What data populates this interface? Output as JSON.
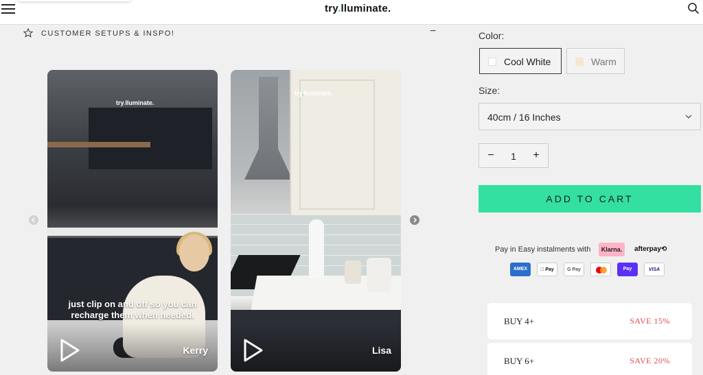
{
  "header": {
    "brand_prefix": "try",
    "brand_dot": ".",
    "brand_suffix": "lluminate."
  },
  "section": {
    "title": "CUSTOMER SETUPS & INSPO!",
    "collapse_symbol": "−"
  },
  "videos": [
    {
      "logo_prefix": "try",
      "logo_dot": ".",
      "logo_suffix": "lluminate.",
      "caption": "just clip on and off so you can recharge them when needed.",
      "name": "Kerry"
    },
    {
      "logo_prefix": "try",
      "logo_dot": ".",
      "logo_suffix": "lluminate.",
      "caption": "",
      "name": "Lisa"
    }
  ],
  "product": {
    "color_label": "Color:",
    "color_options": [
      {
        "label": "Cool White",
        "swatch": "#ffffff",
        "selected": true
      },
      {
        "label": "Warm",
        "swatch": "#f7e6cf",
        "selected": false
      }
    ],
    "size_label": "Size:",
    "size_value": "40cm / 16 Inches",
    "quantity": "1",
    "qty_minus": "−",
    "qty_plus": "+",
    "add_to_cart": "ADD TO CART"
  },
  "payment": {
    "instalments_text": "Pay in Easy instalments with",
    "klarna": "Klarna.",
    "afterpay": "afterpay⟲",
    "methods": [
      "AMEX",
      "Pay",
      "G Pay",
      "",
      "Pay",
      "VISA"
    ]
  },
  "bundles": [
    {
      "qty": "BUY 4+",
      "save": "SAVE 15%"
    },
    {
      "qty": "BUY 6+",
      "save": "SAVE 20%"
    }
  ],
  "colors": {
    "accent": "#33e0a1",
    "save_red": "#e14b4b",
    "klarna_pink": "#ffb3c7"
  }
}
